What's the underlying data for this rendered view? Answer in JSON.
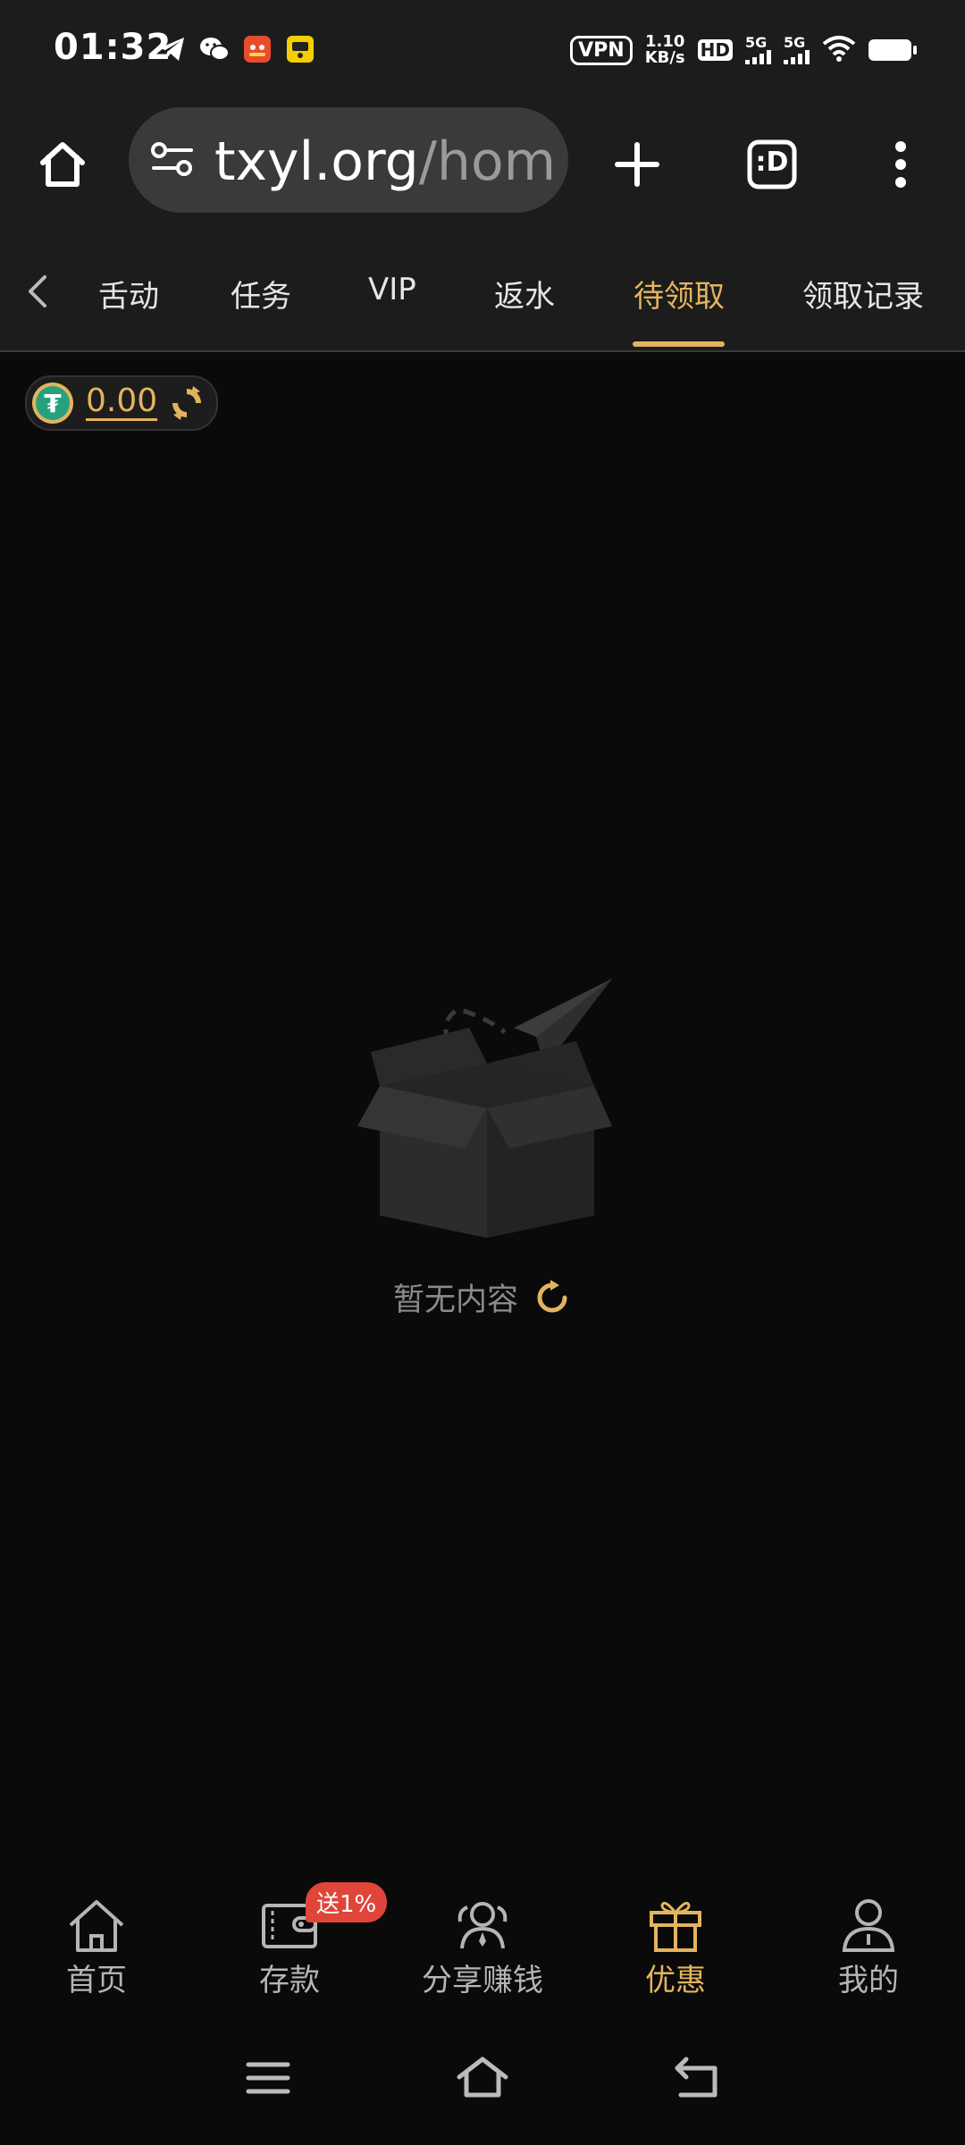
{
  "status_bar": {
    "time": "01:32",
    "vpn": "VPN",
    "speed_value": "1.10",
    "speed_unit": "KB/s",
    "hd": "HD",
    "sim1": "5G",
    "sim2": "5G",
    "notification_icons": [
      "telegram-icon",
      "wechat-icon",
      "taobao-icon",
      "app-icon"
    ]
  },
  "browser": {
    "url_host": "txyl.org",
    "url_path": "/hom",
    "tab_switcher_label": ":D"
  },
  "tabs": {
    "items": [
      "舌动",
      "任务",
      "VIP",
      "返水",
      "待领取",
      "领取记录"
    ],
    "active_index": 4
  },
  "balance": {
    "currency_symbol": "₮",
    "value": "0.00"
  },
  "empty_state": {
    "text": "暂无内容"
  },
  "bottom_nav": {
    "items": [
      {
        "label": "首页",
        "icon": "home-icon"
      },
      {
        "label": "存款",
        "icon": "wallet-icon"
      },
      {
        "label": "分享赚钱",
        "icon": "share-users-icon"
      },
      {
        "label": "优惠",
        "icon": "gift-icon"
      },
      {
        "label": "我的",
        "icon": "profile-icon"
      }
    ],
    "active_index": 3,
    "deposit_badge": "送1%"
  },
  "colors": {
    "accent": "#e3b45e",
    "background": "#0a0a0a",
    "toolbar": "#1c1c1c",
    "badge": "#e0453a"
  }
}
